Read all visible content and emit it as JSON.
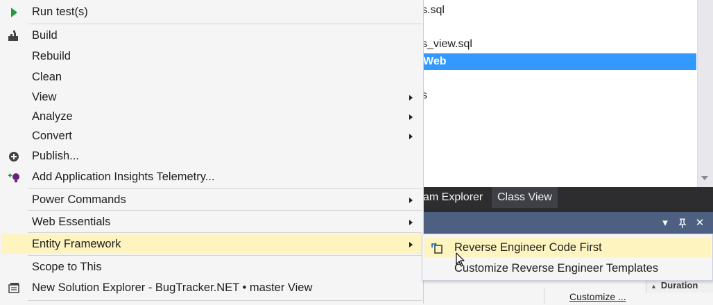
{
  "background": {
    "explorer_rows": [
      "s.sql",
      "s_view.sql",
      "Web",
      "s"
    ],
    "tabs": [
      "am Explorer",
      "Class View"
    ],
    "panel_buttons": [
      "▾",
      "⊣",
      "✕"
    ],
    "duration_header": "Duration",
    "customize_link": "Customize ..."
  },
  "menu": {
    "items": [
      {
        "label": "Run test(s)",
        "icon": "run-icon"
      },
      {
        "label": "Build",
        "icon": "build-icon"
      },
      {
        "label": "Rebuild"
      },
      {
        "label": "Clean"
      },
      {
        "label": "View",
        "submenu": true
      },
      {
        "label": "Analyze",
        "submenu": true
      },
      {
        "label": "Convert",
        "submenu": true
      },
      {
        "label": "Publish...",
        "icon": "publish-icon"
      },
      {
        "label": "Add Application Insights Telemetry...",
        "icon": "insights-icon"
      },
      {
        "label": "Power Commands",
        "submenu": true
      },
      {
        "label": "Web Essentials",
        "submenu": true
      },
      {
        "label": "Entity Framework",
        "submenu": true,
        "highlighted": true
      },
      {
        "label": "Scope to This"
      },
      {
        "label": "New Solution Explorer - BugTracker.NET • master View",
        "icon": "new-explorer-icon"
      }
    ]
  },
  "submenu": {
    "items": [
      {
        "label": "Reverse Engineer Code First",
        "icon": "reverse-engineer-icon",
        "highlighted": true
      },
      {
        "label": "Customize Reverse Engineer Templates"
      }
    ]
  },
  "colors": {
    "highlight": "#fdf4bf",
    "selection": "#3399ff",
    "panel_header": "#4d6082",
    "tab_strip": "#2d2d30"
  }
}
